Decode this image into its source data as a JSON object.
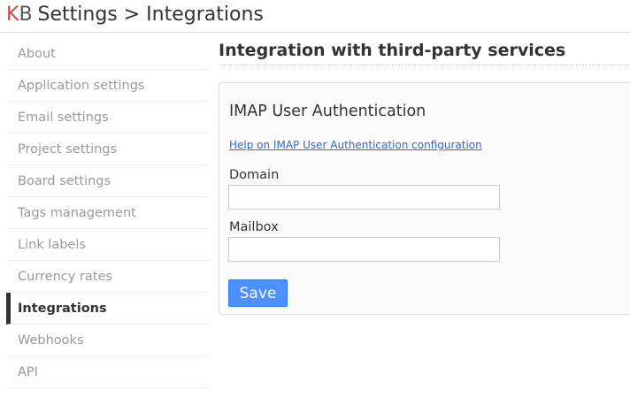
{
  "header": {
    "logo_k": "K",
    "logo_b": "B",
    "title": "Settings > Integrations"
  },
  "sidebar": {
    "items": [
      {
        "label": "About",
        "active": false
      },
      {
        "label": "Application settings",
        "active": false
      },
      {
        "label": "Email settings",
        "active": false
      },
      {
        "label": "Project settings",
        "active": false
      },
      {
        "label": "Board settings",
        "active": false
      },
      {
        "label": "Tags management",
        "active": false
      },
      {
        "label": "Link labels",
        "active": false
      },
      {
        "label": "Currency rates",
        "active": false
      },
      {
        "label": "Integrations",
        "active": true
      },
      {
        "label": "Webhooks",
        "active": false
      },
      {
        "label": "API",
        "active": false
      }
    ]
  },
  "main": {
    "title": "Integration with third-party services",
    "panel": {
      "title": "IMAP User Authentication",
      "help_link": "Help on IMAP User Authentication configuration",
      "domain_label": "Domain",
      "domain_value": "",
      "mailbox_label": "Mailbox",
      "mailbox_value": "",
      "save_label": "Save"
    }
  },
  "colors": {
    "logo_k": "#d14836",
    "link": "#3366cc",
    "primary_button": "#4d90fe",
    "active_indicator": "#333333",
    "inactive_text": "#999999"
  }
}
